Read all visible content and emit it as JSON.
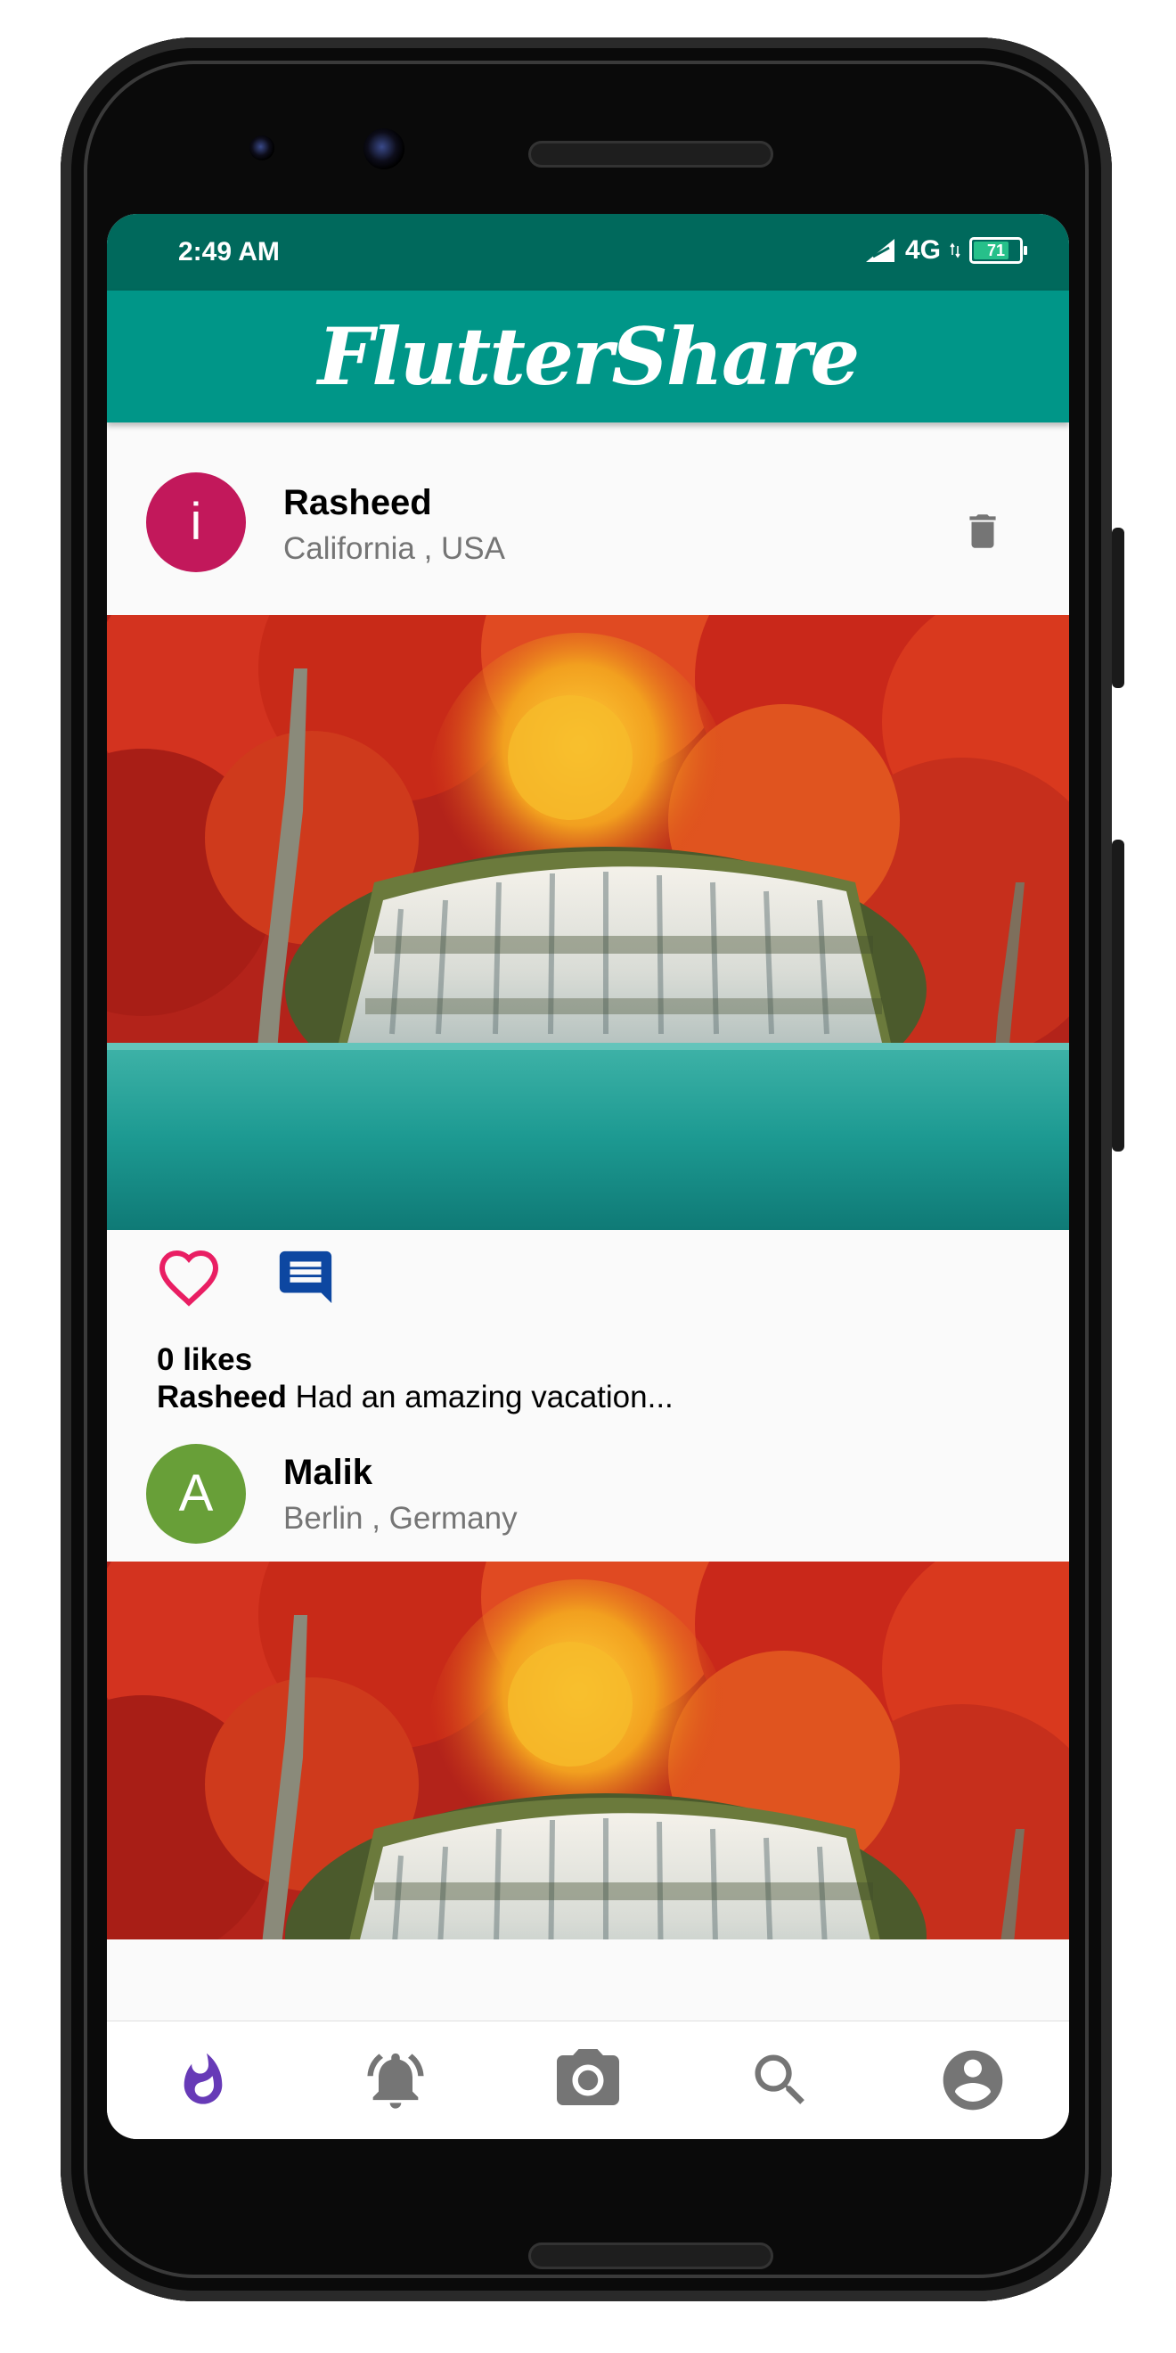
{
  "status_bar": {
    "time": "2:49 AM",
    "network": "4G",
    "battery_level": "71"
  },
  "app_bar": {
    "title": "FlutterShare"
  },
  "posts": [
    {
      "username": "Rasheed",
      "location": "California , USA",
      "avatar_letter": "i",
      "avatar_color": "#c2185b",
      "likes_text": "0 likes",
      "caption_user": "Rasheed",
      "caption_text": "Had an amazing vacation..."
    },
    {
      "username": "Malik",
      "location": "Berlin , Germany",
      "avatar_letter": "A",
      "avatar_color": "#689f38"
    }
  ],
  "bottom_nav": {
    "items": [
      "whatshot-icon",
      "notifications-active-icon",
      "photo-camera-icon",
      "search-icon",
      "account-circle-icon"
    ],
    "active_index": 0,
    "active_color": "#673ab7",
    "inactive_color": "#757575"
  },
  "colors": {
    "primary": "#009688",
    "primary_dark": "#00695c",
    "like": "#e91e63",
    "comment": "#0d47a1"
  }
}
